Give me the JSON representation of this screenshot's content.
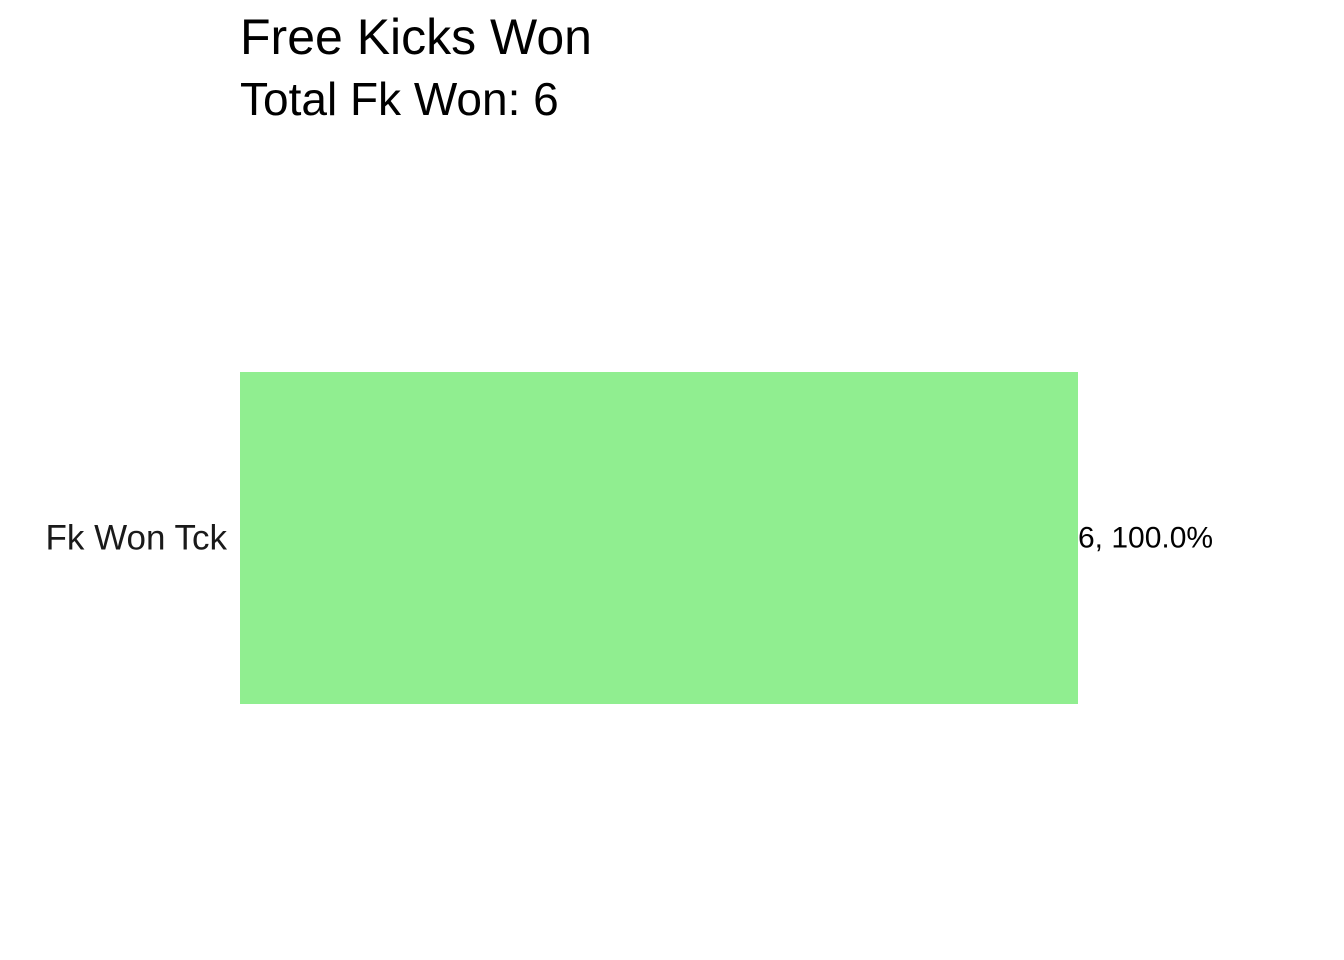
{
  "chart_data": {
    "type": "bar",
    "orientation": "horizontal",
    "title": "Free Kicks Won",
    "subtitle": "Total Fk Won: 6",
    "categories": [
      "Fk Won Tck"
    ],
    "values": [
      6
    ],
    "data_labels": [
      "6, 100.0%"
    ],
    "xlim": [
      0,
      6
    ],
    "grid": false,
    "legend": "none",
    "bar_color": "#90EE90"
  }
}
